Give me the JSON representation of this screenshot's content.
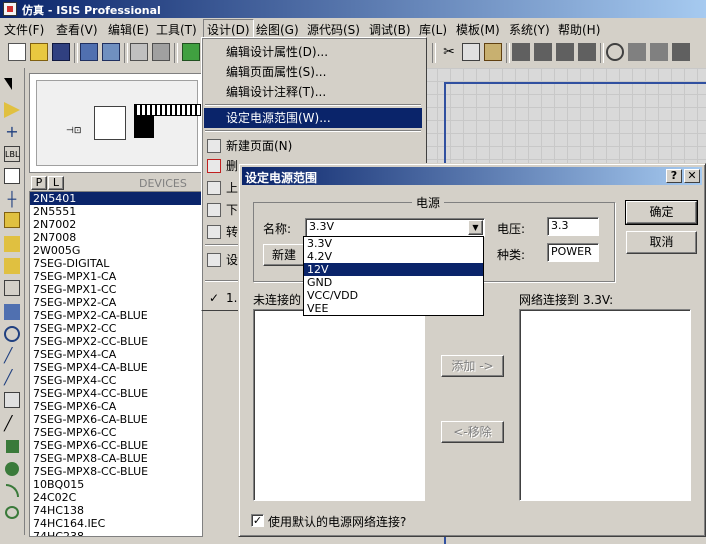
{
  "app": {
    "title": "仿真 - ISIS Professional"
  },
  "menubar": [
    "文件(F)",
    "查看(V)",
    "编辑(E)",
    "工具(T)",
    "设计(D)",
    "绘图(G)",
    "源代码(S)",
    "调试(B)",
    "库(L)",
    "模板(M)",
    "系统(Y)",
    "帮助(H)"
  ],
  "design_menu": {
    "items": [
      {
        "label": "编辑设计属性(D)...",
        "icon": ""
      },
      {
        "label": "编辑页面属性(S)...",
        "icon": ""
      },
      {
        "label": "编辑设计注释(T)...",
        "icon": ""
      },
      {
        "label": "设定电源范围(W)...",
        "icon": "",
        "highlighted": true
      },
      {
        "label": "新建页面(N)",
        "icon": "new-page-icon"
      },
      {
        "label": "删",
        "icon": "delete-page-icon"
      },
      {
        "label": "上",
        "icon": "page-up-icon"
      },
      {
        "label": "下",
        "icon": "page-down-icon"
      },
      {
        "label": "转",
        "icon": "goto-page-icon"
      },
      {
        "label": "设",
        "icon": "root-sheet-icon"
      },
      {
        "label": "1.",
        "icon": "check-icon"
      }
    ]
  },
  "devices": {
    "tab_p": "P",
    "tab_l": "L",
    "header": "DEVICES",
    "items": [
      "2N5401",
      "2N5551",
      "2N7002",
      "2N7008",
      "2W005G",
      "7SEG-DIGITAL",
      "7SEG-MPX1-CA",
      "7SEG-MPX1-CC",
      "7SEG-MPX2-CA",
      "7SEG-MPX2-CA-BLUE",
      "7SEG-MPX2-CC",
      "7SEG-MPX2-CC-BLUE",
      "7SEG-MPX4-CA",
      "7SEG-MPX4-CA-BLUE",
      "7SEG-MPX4-CC",
      "7SEG-MPX4-CC-BLUE",
      "7SEG-MPX6-CA",
      "7SEG-MPX6-CA-BLUE",
      "7SEG-MPX6-CC",
      "7SEG-MPX6-CC-BLUE",
      "7SEG-MPX8-CA-BLUE",
      "7SEG-MPX8-CC-BLUE",
      "10BQ015",
      "24C02C",
      "74HC138",
      "74HC164.IEC",
      "74HC238"
    ],
    "selected_index": 0
  },
  "dialog": {
    "title": "设定电源范围",
    "help_btn": "?",
    "close_btn": "✕",
    "group_label": "电源",
    "name_label": "名称:",
    "name_value": "3.3V",
    "new_btn": "新建",
    "voltage_label": "电压:",
    "voltage_value": "3.3",
    "type_label": "种类:",
    "type_value": "POWER",
    "ok": "确定",
    "cancel": "取消",
    "unconnected_label": "未连接的",
    "connected_label": "网络连接到 3.3V:",
    "add_btn": "添加 ->",
    "remove_btn": "<-移除",
    "checkbox_label": "使用默认的电源网络连接?",
    "checkbox_checked": true,
    "dropdown_options": [
      "3.3V",
      "4.2V",
      "12V",
      "GND",
      "VCC/VDD",
      "VEE"
    ],
    "dropdown_selected_index": 2
  },
  "colors": {
    "titlebar": "#0a246a",
    "selection": "#0a246a",
    "face": "#d4d0c8"
  }
}
